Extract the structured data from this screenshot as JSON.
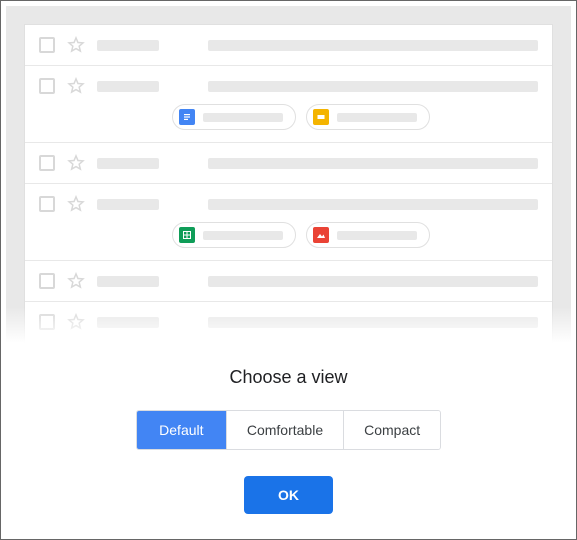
{
  "dialog": {
    "title": "Choose a view",
    "ok_label": "OK"
  },
  "view_options": {
    "default": "Default",
    "comfortable": "Comfortable",
    "compact": "Compact",
    "selected": "default"
  },
  "preview": {
    "rows": [
      {
        "attachments": []
      },
      {
        "attachments": [
          {
            "type": "docs"
          },
          {
            "type": "slides"
          }
        ]
      },
      {
        "attachments": []
      },
      {
        "attachments": [
          {
            "type": "sheets"
          },
          {
            "type": "image"
          }
        ]
      },
      {
        "attachments": []
      },
      {
        "attachments": []
      }
    ]
  },
  "icons": {
    "docs": "docs-icon",
    "slides": "slides-icon",
    "sheets": "sheets-icon",
    "image": "image-icon"
  }
}
